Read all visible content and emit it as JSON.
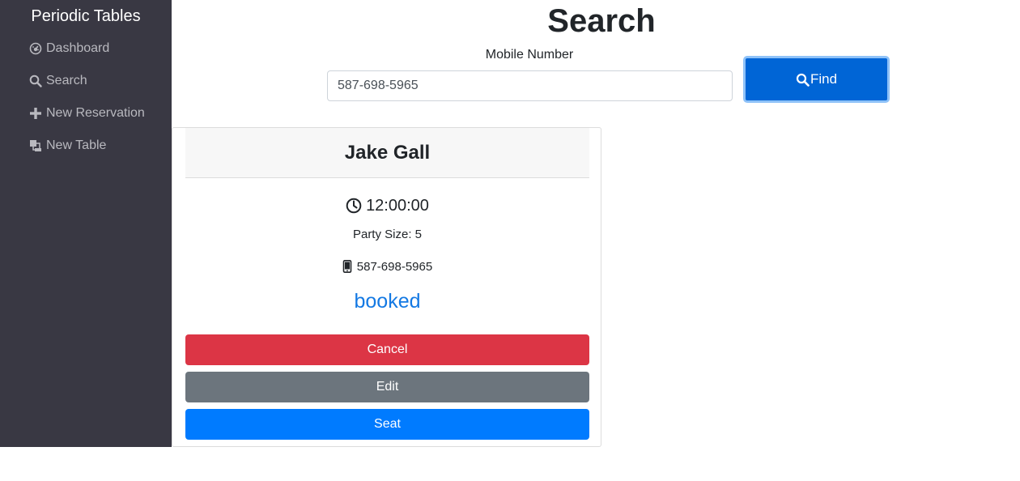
{
  "sidebar": {
    "brand": "Periodic Tables",
    "items": [
      {
        "label": "Dashboard",
        "icon": "dashboard-icon"
      },
      {
        "label": "Search",
        "icon": "search-icon"
      },
      {
        "label": "New Reservation",
        "icon": "plus-icon"
      },
      {
        "label": "New Table",
        "icon": "table-icon"
      }
    ]
  },
  "main": {
    "title": "Search",
    "search": {
      "label": "Mobile Number",
      "value": "587-698-5965",
      "button_label": "Find",
      "button_icon": "search-icon"
    }
  },
  "reservation": {
    "name": "Jake Gall",
    "time": "12:00:00",
    "time_icon": "clock-icon",
    "party_size": "Party Size: 5",
    "phone": "587-698-5965",
    "phone_icon": "mobile-phone-icon",
    "status": "booked",
    "actions": {
      "cancel": "Cancel",
      "edit": "Edit",
      "seat": "Seat"
    }
  },
  "colors": {
    "sidebar_bg": "#393843",
    "primary": "#007bff",
    "danger": "#dc3545",
    "secondary": "#6c757d",
    "status": "#1479e3"
  }
}
